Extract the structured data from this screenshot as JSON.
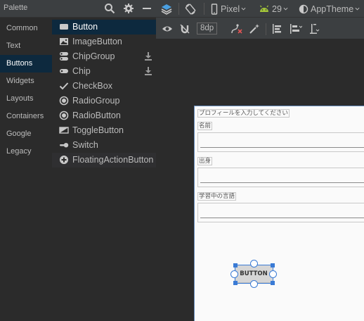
{
  "palette": {
    "title": "Palette",
    "categories": [
      {
        "label": "Common"
      },
      {
        "label": "Text"
      },
      {
        "label": "Buttons"
      },
      {
        "label": "Widgets"
      },
      {
        "label": "Layouts"
      },
      {
        "label": "Containers"
      },
      {
        "label": "Google"
      },
      {
        "label": "Legacy"
      }
    ],
    "selected_category": "Buttons",
    "widgets": [
      {
        "label": "Button",
        "icon": "button-icon"
      },
      {
        "label": "ImageButton",
        "icon": "image-icon"
      },
      {
        "label": "ChipGroup",
        "icon": "chip-group-icon",
        "downloadable": true
      },
      {
        "label": "Chip",
        "icon": "chip-icon",
        "downloadable": true
      },
      {
        "label": "CheckBox",
        "icon": "checkmark-icon"
      },
      {
        "label": "RadioGroup",
        "icon": "radio-icon"
      },
      {
        "label": "RadioButton",
        "icon": "radio-icon"
      },
      {
        "label": "ToggleButton",
        "icon": "toggle-icon"
      },
      {
        "label": "Switch",
        "icon": "switch-icon"
      },
      {
        "label": "FloatingActionButton",
        "icon": "plus-circle-icon"
      }
    ]
  },
  "toolbar": {
    "device": "Pixel",
    "api_level": "29",
    "theme": "AppTheme",
    "margin_value": "8dp"
  },
  "layout_preview": {
    "header_label": "プロフィールを入力してください",
    "name_label": "名前",
    "origin_label": "出身",
    "language_label": "学習中の言語",
    "button_text": "BUTTON"
  },
  "colors": {
    "selection_bg": "#0d293e",
    "handle_blue": "#3a7bd5",
    "android_green": "#a4c639"
  }
}
